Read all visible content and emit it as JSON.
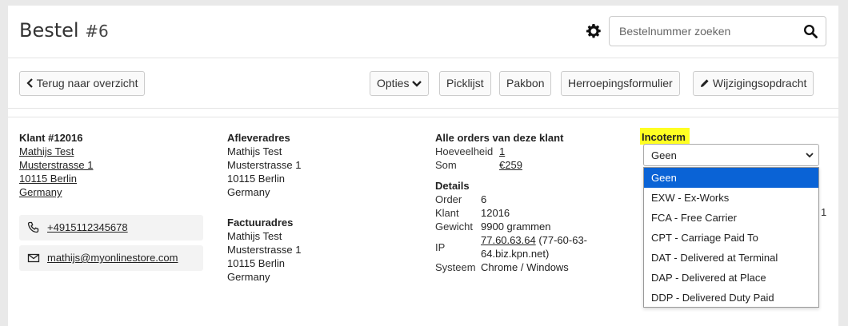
{
  "header": {
    "title": "Bestel",
    "order_number": "#6",
    "search_placeholder": "Bestelnummer zoeken"
  },
  "toolbar": {
    "back_label": "Terug naar overzicht",
    "options_label": "Opties",
    "picklist_label": "Picklijst",
    "packing_label": "Pakbon",
    "withdrawal_label": "Herroepingsformulier",
    "change_label": "Wijzigingsopdracht"
  },
  "customer": {
    "heading": "Klant #12016",
    "name": "Mathijs Test",
    "street": "Musterstrasse 1",
    "city": "10115 Berlin",
    "country": "Germany",
    "phone": "+4915112345678",
    "email": "mathijs@myonlinestore.com"
  },
  "delivery": {
    "heading": "Afleveradres",
    "name": "Mathijs Test",
    "street": "Musterstrasse 1",
    "city": "10115 Berlin",
    "country": "Germany"
  },
  "invoice": {
    "heading": "Factuuradres",
    "name": "Mathijs Test",
    "street": "Musterstrasse 1",
    "city": "10115 Berlin",
    "country": "Germany"
  },
  "orders": {
    "heading": "Alle orders van deze klant",
    "quantity_label": "Hoeveelheid",
    "quantity_value": "1",
    "sum_label": "Som",
    "sum_value": "€259"
  },
  "details": {
    "heading": "Details",
    "order_label": "Order",
    "order_value": "6",
    "customer_label": "Klant",
    "customer_value": "12016",
    "weight_label": "Gewicht",
    "weight_value": "9900 grammen",
    "ip_label": "IP",
    "ip_value": "77.60.63.64",
    "ip_host": "(77-60-63-64.biz.kpn.net)",
    "system_label": "Systeem",
    "system_value": "Chrome / Windows"
  },
  "incoterm": {
    "label": "Incoterm",
    "selected": "Geen",
    "options": [
      "Geen",
      "EXW - Ex-Works",
      "FCA - Free Carrier",
      "CPT - Carriage Paid To",
      "DAT - Delivered at Terminal",
      "DAP - Delivered at Place",
      "DDP - Delivered Duty Paid"
    ],
    "peek_text": "1"
  },
  "colors": {
    "highlight": "#ffff22",
    "selected_option": "#0a63d6",
    "background": "#e9e9e9"
  }
}
